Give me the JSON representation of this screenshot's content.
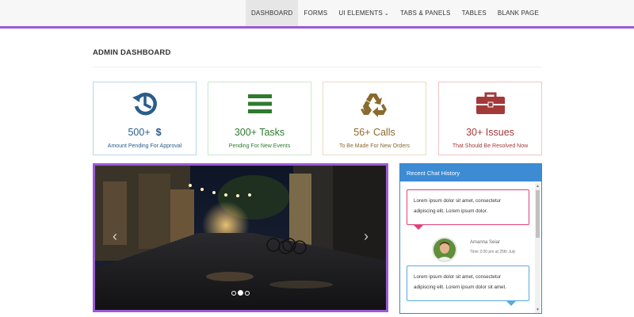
{
  "nav": {
    "items": [
      {
        "label": "DASHBOARD"
      },
      {
        "label": "FORMS"
      },
      {
        "label": "UI ELEMENTS"
      },
      {
        "label": "TABS & PANELS"
      },
      {
        "label": "TABLES"
      },
      {
        "label": "BLANK PAGE"
      }
    ]
  },
  "page": {
    "title": "ADMIN DASHBOARD"
  },
  "cards": [
    {
      "value": "500+",
      "extra": "$",
      "label": "Amount Pending For Approval",
      "icon": "history-icon",
      "color": "#2a5d8a"
    },
    {
      "value": "300+ Tasks",
      "label": "Pending For New Events",
      "icon": "bars-icon",
      "color": "#2f7a2f"
    },
    {
      "value": "56+ Calls",
      "label": "To Be Made For New Orders",
      "icon": "recycle-icon",
      "color": "#8a6a2d"
    },
    {
      "value": "30+ Issues",
      "label": "That Should Be Resolved Now",
      "icon": "briefcase-icon",
      "color": "#a33a3a"
    }
  ],
  "carousel": {
    "prev": "‹",
    "next": "›"
  },
  "chat": {
    "title": "Recent Chat History",
    "messages": [
      {
        "text": "Lorem ipsum dolor sit amet, consectetur adipiscing elit. Lorem ipsum dolor."
      },
      {
        "text": "Lorem ipsum dolor sit amet, consectetur adipiscing elit. Lorem ipsum dolor sit amet."
      }
    ],
    "user": {
      "name": "Amanna Seiar",
      "time": "Time 2:00 pm at 25th July"
    }
  },
  "colors": {
    "accent": "#9b59d6",
    "chat_header": "#3d8bd3"
  }
}
